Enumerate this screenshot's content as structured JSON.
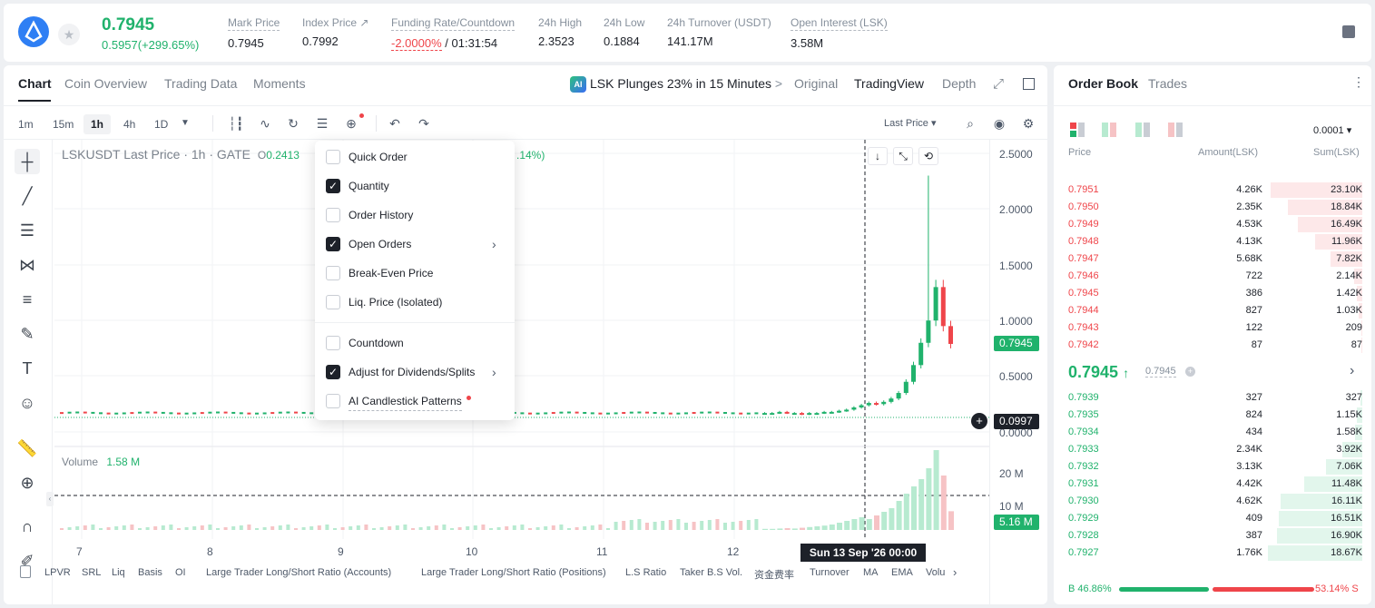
{
  "header": {
    "last_price": "0.7945",
    "change": "0.5957(+299.65%)",
    "stats": [
      {
        "label": "Mark Price",
        "value": "0.7945"
      },
      {
        "label": "Index Price ↗",
        "value": "0.7992"
      },
      {
        "label": "Funding Rate/Countdown",
        "value_red": "-2.0000%",
        "value_rest": "/ 01:31:54"
      },
      {
        "label": "24h High",
        "value": "2.3523"
      },
      {
        "label": "24h Low",
        "value": "0.1884"
      },
      {
        "label": "24h Turnover (USDT)",
        "value": "141.17M"
      },
      {
        "label": "Open Interest (LSK)",
        "value": "3.58M"
      }
    ]
  },
  "chart_tabs": {
    "chart": "Chart",
    "coin_overview": "Coin Overview",
    "trading_data": "Trading Data",
    "moments": "Moments",
    "news": "LSK Plunges 23% in 15 Minutes",
    "news_arrow": ">",
    "original": "Original",
    "tradingview": "TradingView",
    "depth": "Depth",
    "ai": "AI"
  },
  "toolbar": {
    "timeframes": [
      "1m",
      "15m",
      "1h",
      "4h",
      "1D"
    ],
    "active_timeframe": "1h",
    "price_type": "Last Price ▾"
  },
  "legend": {
    "symbol": "LSKUSDT Last Price · 1h · GATE",
    "o_label": "O",
    "o_value": "0.2413",
    "change_fragment": ".14%)",
    "volume_label": "Volume",
    "volume_value": "1.58 M"
  },
  "y_axis": {
    "ticks": [
      "2.5000",
      "2.0000",
      "1.5000",
      "1.0000",
      "0.5000",
      "0.0000"
    ],
    "vol_ticks": [
      "20 M",
      "10 M"
    ],
    "current_price_tag": "0.7945",
    "crosshair_price_tag": "0.0997",
    "volume_tag": "5.16 M"
  },
  "x_axis": {
    "ticks": [
      "7",
      "8",
      "9",
      "10",
      "11",
      "12"
    ],
    "crosshair_date": "Sun 13 Sep '26   00:00"
  },
  "indicators": [
    "LPVR",
    "SRL",
    "Liq",
    "Basis",
    "OI",
    "Large Trader Long/Short Ratio (Accounts)",
    "Large Trader Long/Short Ratio (Positions)",
    "L.S Ratio",
    "Taker B.S Vol.",
    "资金费率",
    "Turnover",
    "MA",
    "EMA",
    "Volu"
  ],
  "menu": {
    "items": [
      {
        "label": "Quick Order",
        "checked": false
      },
      {
        "label": "Quantity",
        "checked": true
      },
      {
        "label": "Order History",
        "checked": false
      },
      {
        "label": "Open Orders",
        "checked": true,
        "arrow": true
      },
      {
        "label": "Break-Even Price",
        "checked": false
      },
      {
        "label": "Liq. Price (Isolated)",
        "checked": false
      },
      {
        "label": "Countdown",
        "checked": false
      },
      {
        "label": "Adjust for Dividends/Splits",
        "checked": true,
        "arrow": true
      },
      {
        "label": "AI Candlestick Patterns",
        "checked": false,
        "dot": true
      }
    ]
  },
  "orderbook": {
    "tab_orderbook": "Order Book",
    "tab_trades": "Trades",
    "precision": "0.0001 ▾",
    "col_price": "Price",
    "col_amount": "Amount(LSK)",
    "col_sum": "Sum(LSK)",
    "asks": [
      {
        "price": "0.7951",
        "amount": "4.26K",
        "sum": "23.10K",
        "depth": 0.96
      },
      {
        "price": "0.7950",
        "amount": "2.35K",
        "sum": "18.84K",
        "depth": 0.78
      },
      {
        "price": "0.7949",
        "amount": "4.53K",
        "sum": "16.49K",
        "depth": 0.68
      },
      {
        "price": "0.7948",
        "amount": "4.13K",
        "sum": "11.96K",
        "depth": 0.5
      },
      {
        "price": "0.7947",
        "amount": "5.68K",
        "sum": "7.82K",
        "depth": 0.33
      },
      {
        "price": "0.7946",
        "amount": "722",
        "sum": "2.14K",
        "depth": 0.09
      },
      {
        "price": "0.7945",
        "amount": "386",
        "sum": "1.42K",
        "depth": 0.06
      },
      {
        "price": "0.7944",
        "amount": "827",
        "sum": "1.03K",
        "depth": 0.04
      },
      {
        "price": "0.7943",
        "amount": "122",
        "sum": "209",
        "depth": 0.01
      },
      {
        "price": "0.7942",
        "amount": "87",
        "sum": "87",
        "depth": 0.005
      }
    ],
    "mid_price": "0.7945",
    "mid_arrow": "↑",
    "mark_price": "0.7945",
    "bids": [
      {
        "price": "0.7939",
        "amount": "327",
        "sum": "327",
        "depth": 0.02
      },
      {
        "price": "0.7935",
        "amount": "824",
        "sum": "1.15K",
        "depth": 0.06
      },
      {
        "price": "0.7934",
        "amount": "434",
        "sum": "1.58K",
        "depth": 0.08
      },
      {
        "price": "0.7933",
        "amount": "2.34K",
        "sum": "3.92K",
        "depth": 0.21
      },
      {
        "price": "0.7932",
        "amount": "3.13K",
        "sum": "7.06K",
        "depth": 0.38
      },
      {
        "price": "0.7931",
        "amount": "4.42K",
        "sum": "11.48K",
        "depth": 0.61
      },
      {
        "price": "0.7930",
        "amount": "4.62K",
        "sum": "16.11K",
        "depth": 0.86
      },
      {
        "price": "0.7929",
        "amount": "409",
        "sum": "16.51K",
        "depth": 0.88
      },
      {
        "price": "0.7928",
        "amount": "387",
        "sum": "16.90K",
        "depth": 0.9
      },
      {
        "price": "0.7927",
        "amount": "1.76K",
        "sum": "18.67K",
        "depth": 0.99
      }
    ],
    "buy_ratio_label": "B 46.86%",
    "sell_ratio_label": "53.14% S",
    "buy_ratio": 0.4686
  },
  "colors": {
    "up": "#20b26c",
    "down": "#ef454a",
    "up_bar": "#b7ead0",
    "down_bar": "#f6c3c5"
  },
  "chart_data": {
    "type": "candlestick",
    "x_ticks": [
      "7",
      "8",
      "9",
      "10",
      "11",
      "12"
    ],
    "ylim": [
      0,
      2.5
    ],
    "series": [
      {
        "name": "price",
        "values": [
          0.17,
          0.17,
          0.18,
          0.17,
          0.17,
          0.16,
          0.17,
          0.17,
          0.18,
          0.18,
          0.19,
          0.2,
          0.22,
          0.24,
          0.26,
          0.25,
          0.27,
          0.3,
          0.35,
          0.45,
          0.6,
          0.8,
          1.0,
          1.3,
          0.95,
          0.79
        ]
      },
      {
        "name": "volume (M)",
        "values": [
          0.3,
          0.3,
          0.4,
          0.5,
          0.4,
          0.6,
          0.8,
          1.0,
          1.2,
          1.5,
          2.0,
          2.5,
          3.0,
          3.5,
          3.0,
          4.0,
          5.0,
          6.0,
          8.0,
          10.0,
          12.0,
          14.0,
          17.0,
          22.0,
          15.0,
          5.16
        ]
      }
    ]
  }
}
